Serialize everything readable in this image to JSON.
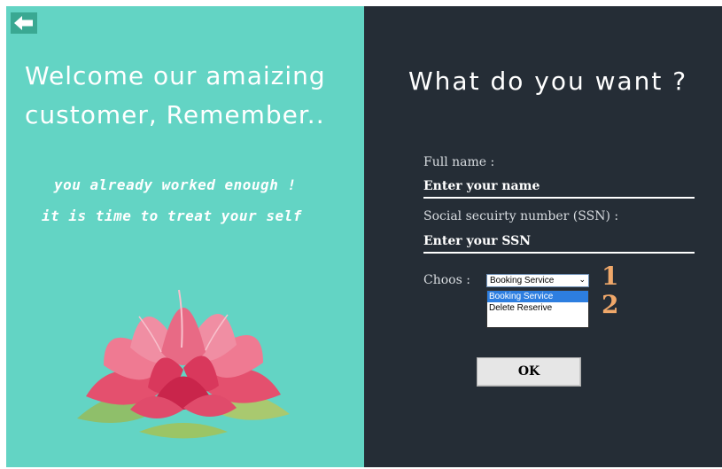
{
  "left_panel": {
    "back_icon": "arrow-left-icon",
    "welcome_line1": "Welcome our amaizing",
    "welcome_line2": "customer, Remember..",
    "tagline1": "you already worked enough !",
    "tagline2": "it is time to treat your self",
    "image": "lotus-flower"
  },
  "right_panel": {
    "title": "What do you want ?",
    "full_name_label": "Full name :",
    "full_name_placeholder": "Enter your name",
    "ssn_label": "Social secuirty number (SSN) :",
    "ssn_placeholder": "Enter your SSN",
    "choose_label": "Choos :",
    "select_value": "Booking Service",
    "options": [
      "Booking Service",
      "Delete Reserive"
    ],
    "annotation_1": "1",
    "annotation_2": "2",
    "ok_label": "OK"
  },
  "colors": {
    "left_bg": "#63d4c4",
    "right_bg": "#252d36",
    "selected_option": "#2d7ee0",
    "annotation": "#f0a86a"
  }
}
